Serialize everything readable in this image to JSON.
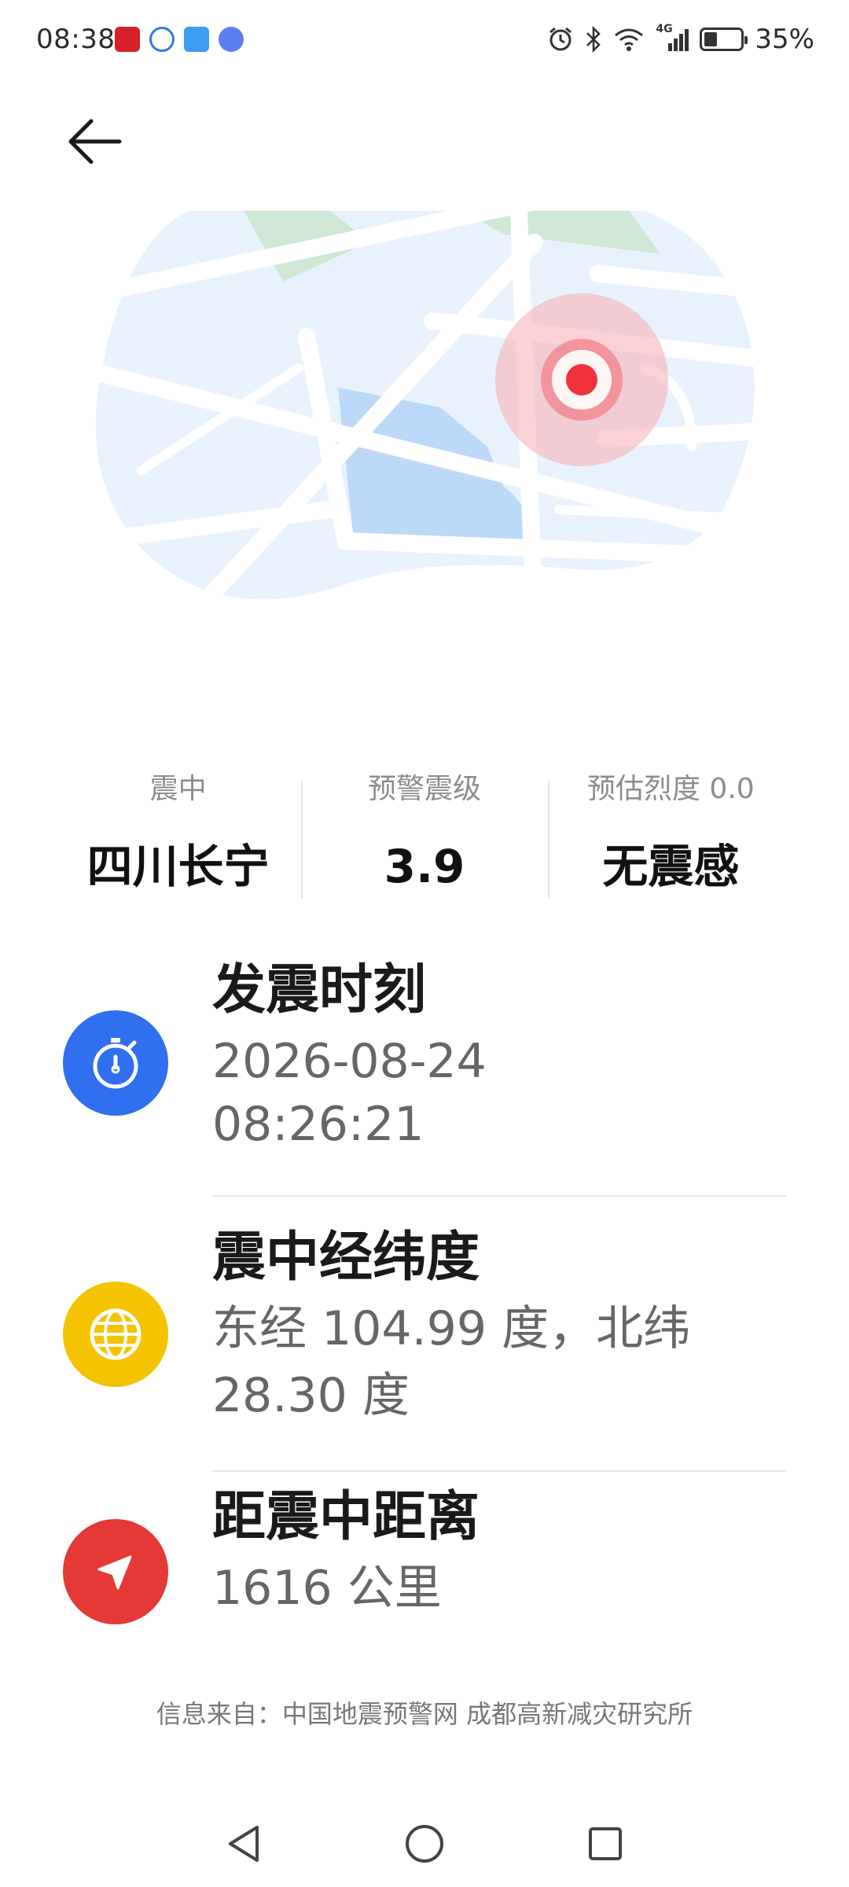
{
  "status_bar": {
    "time": "08:38",
    "network": "4G",
    "battery_percent": "35%"
  },
  "summary": {
    "epicenter_label": "震中",
    "epicenter_value": "四川长宁",
    "magnitude_label": "预警震级",
    "magnitude_value": "3.9",
    "intensity_label": "预估烈度 0.0",
    "intensity_value": "无震感"
  },
  "details": {
    "time": {
      "title": "发震时刻",
      "value_line1": "2026-08-24",
      "value_line2": "08:26:21",
      "icon": "stopwatch-icon",
      "color": "#2f6ff0"
    },
    "coordinates": {
      "title": "震中经纬度",
      "value_line1": "东经 104.99 度，北纬",
      "value_line2": "28.30 度",
      "icon": "globe-icon",
      "color": "#f5c400"
    },
    "distance": {
      "title": "距震中距离",
      "value_line1": "1616 公里",
      "icon": "navigation-arrow-icon",
      "color": "#e53935"
    }
  },
  "footer": {
    "source": "信息来自：中国地震预警网 成都高新减灾研究所"
  },
  "colors": {
    "map_bg": "#e8f2fd",
    "map_water": "#bcd9f7",
    "map_park": "#cfe8d6",
    "marker": "#f0333a"
  }
}
